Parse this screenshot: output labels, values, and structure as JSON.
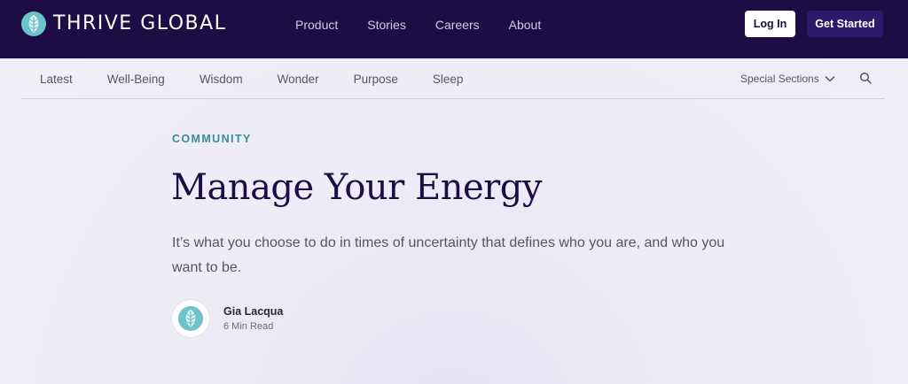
{
  "header": {
    "brand": "THRIVE GLOBAL",
    "nav": [
      "Product",
      "Stories",
      "Careers",
      "About"
    ],
    "login_label": "Log In",
    "get_started_label": "Get Started"
  },
  "subnav": {
    "items": [
      "Latest",
      "Well-Being",
      "Wisdom",
      "Wonder",
      "Purpose",
      "Sleep"
    ],
    "special_label": "Special Sections"
  },
  "article": {
    "category": "COMMUNITY",
    "title": "Manage Your Energy",
    "subtitle": "It’s what you choose to do in times of uncertainty that defines who you are, and who you want to be.",
    "author": "Gia Lacqua",
    "read_time": "6 Min Read"
  },
  "icons": {
    "brand": "leaf-logo-icon",
    "special_sections": "chevron-down-icon",
    "search": "search-icon",
    "avatar": "leaf-avatar-icon"
  },
  "colors": {
    "header_bg": "#1c0e45",
    "accent_teal": "#3b8a94",
    "title": "#1c0e45",
    "get_started_bg": "#2c1a6b",
    "page_bg": "#f0eff8"
  }
}
